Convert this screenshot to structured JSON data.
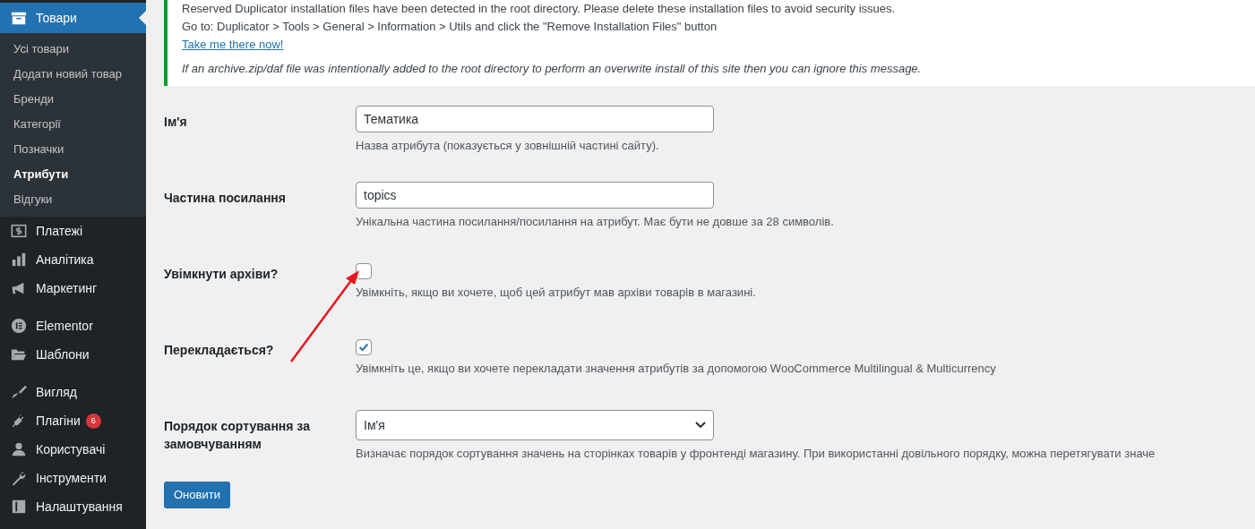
{
  "sidebar": {
    "items": [
      {
        "label": "Товари",
        "selected": true,
        "children": [
          {
            "label": "Усі товари",
            "selected": false
          },
          {
            "label": "Додати новий товар",
            "selected": false
          },
          {
            "label": "Бренди",
            "selected": false
          },
          {
            "label": "Категорії",
            "selected": false
          },
          {
            "label": "Позначки",
            "selected": false
          },
          {
            "label": "Атрибути",
            "selected": true
          },
          {
            "label": "Відгуки",
            "selected": false
          }
        ]
      },
      {
        "label": "Платежі",
        "selected": false
      },
      {
        "label": "Аналітика",
        "selected": false
      },
      {
        "label": "Маркетинг",
        "selected": false
      },
      {
        "label": "Elementor",
        "selected": false
      },
      {
        "label": "Шаблони",
        "selected": false
      },
      {
        "label": "Вигляд",
        "selected": false
      },
      {
        "label": "Плагіни",
        "selected": false,
        "badge": "6"
      },
      {
        "label": "Користувачі",
        "selected": false
      },
      {
        "label": "Інструменти",
        "selected": false
      },
      {
        "label": "Налаштування",
        "selected": false
      }
    ]
  },
  "notice": {
    "lines": [
      "Reserved Duplicator installation files have been detected in the root directory. Please delete these installation files to avoid security issues.",
      "Go to: Duplicator > Tools > General > Information > Utils and click the \"Remove Installation Files\" button"
    ],
    "link": "Take me there now!",
    "note": "If an archive.zip/daf file was intentionally added to the root directory to perform an overwrite install of this site then you can ignore this message."
  },
  "form": [
    {
      "kind": "text",
      "label": "Ім'я",
      "value": "Тематика",
      "description": "Назва атрибута (показується у зовнішній частині сайту)."
    },
    {
      "kind": "text",
      "label": "Частина посилання",
      "value": "topics",
      "description": "Унікальна частина посилання/посилання на атрибут. Має бути не довше за 28 символів."
    },
    {
      "kind": "checkbox",
      "label": "Увімкнути архіви?",
      "checked": false,
      "description": "Увімкніть, якщо ви хочете, щоб цей атрибут мав архіви товарів в магазині."
    },
    {
      "kind": "checkbox",
      "label": "Перекладається?",
      "checked": true,
      "description": "Увімкніть це, якщо ви хочете перекладати значення атрибутів за допомогою WooCommerce Multilingual & Multicurrency"
    },
    {
      "kind": "select",
      "label": "Порядок сортування за замовчуванням",
      "value": "Ім'я",
      "description": "Визначає порядок сортування значень на сторінках товарів у фронтенді магазину. При використанні довільного порядку, можна перетягувати значе"
    }
  ],
  "submit": "Оновити"
}
